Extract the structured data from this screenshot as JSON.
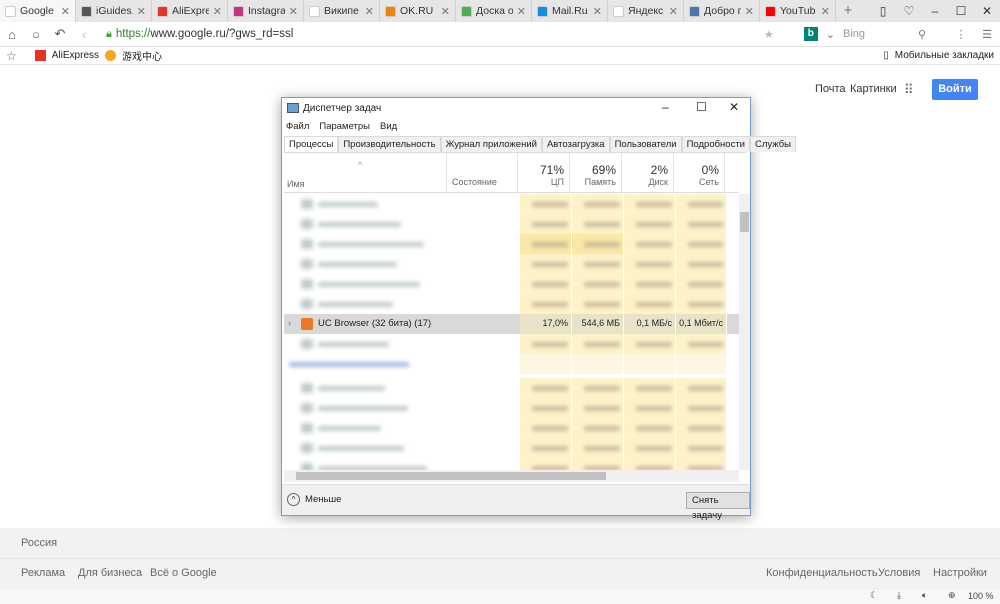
{
  "browser": {
    "tabs": [
      {
        "label": "Google",
        "color": "#ffffff",
        "active": true
      },
      {
        "label": "iGuides.r",
        "color": "#555555"
      },
      {
        "label": "AliExpres",
        "color": "#e43225"
      },
      {
        "label": "Instagra",
        "color": "#c13584"
      },
      {
        "label": "Википе",
        "color": "#ffffff"
      },
      {
        "label": "OK.RU",
        "color": "#ee8208"
      },
      {
        "label": "Доска о",
        "color": "#4caf50"
      },
      {
        "label": "Mail.Ru",
        "color": "#168de2"
      },
      {
        "label": "Яндекс",
        "color": "#ffffff"
      },
      {
        "label": "Добро п",
        "color": "#4a76a8"
      },
      {
        "label": "YouTub",
        "color": "#ff0000"
      }
    ],
    "url_scheme": "https://",
    "url_rest": "www.google.ru/?gws_rd=ssl",
    "search_engine": "Bing",
    "bookmarks": [
      "AliExpress",
      "游戏中心"
    ],
    "mobile_bookmarks": "Мобильные закладки",
    "zoom": "100 %"
  },
  "google": {
    "mail": "Почта",
    "images": "Картинки",
    "signin": "Войти",
    "country": "Россия",
    "footer_left": [
      "Реклама",
      "Для бизнеса",
      "Всё о Google"
    ],
    "footer_right": [
      "Конфиденциальность",
      "Условия",
      "Настройки"
    ]
  },
  "taskmgr": {
    "title": "Диспетчер задач",
    "menu": [
      "Файл",
      "Параметры",
      "Вид"
    ],
    "tabs": [
      "Процессы",
      "Производительность",
      "Журнал приложений",
      "Автозагрузка",
      "Пользователи",
      "Подробности",
      "Службы"
    ],
    "columns": {
      "name": "Имя",
      "status": "Состояние",
      "cpu_pct": "71%",
      "cpu": "ЦП",
      "mem_pct": "69%",
      "mem": "Память",
      "disk_pct": "2%",
      "disk": "Диск",
      "net_pct": "0%",
      "net": "Сеть"
    },
    "process": {
      "name": "UC Browser (32 бита) (17)",
      "cpu": "17,0%",
      "mem": "544,6 МБ",
      "disk": "0,1 МБ/с",
      "net": "0,1 Мбит/с"
    },
    "fewer": "Меньше",
    "end_task": "Снять задачу"
  }
}
